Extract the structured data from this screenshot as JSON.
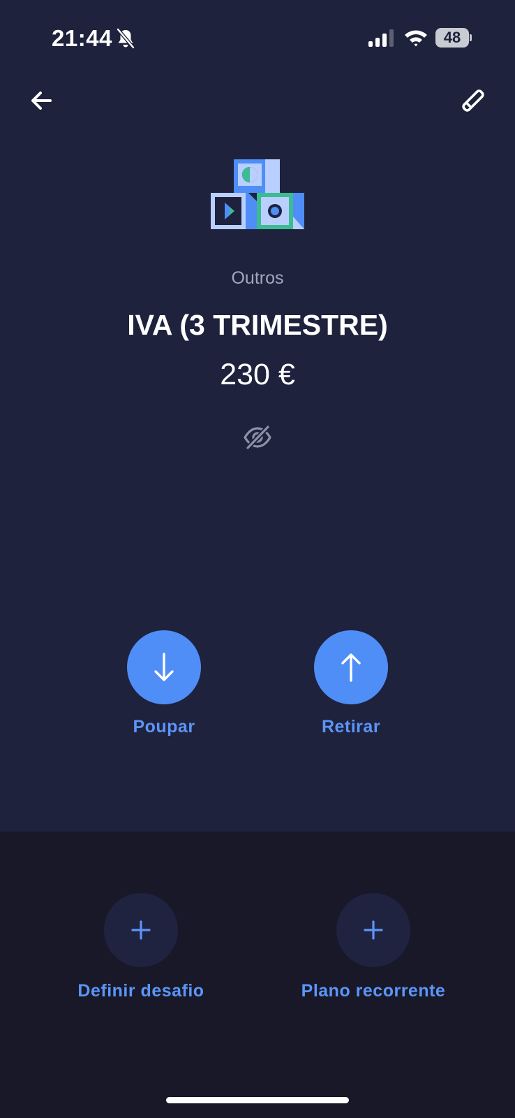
{
  "status_bar": {
    "time": "21:44",
    "battery": "48",
    "icons": [
      "bell-slash-icon",
      "signal-icon",
      "wifi-icon",
      "battery-icon"
    ]
  },
  "header": {
    "back_icon": "arrow-left-icon",
    "edit_icon": "pencil-icon"
  },
  "vault": {
    "category": "Outros",
    "name": "IVA (3 TRIMESTRE)",
    "amount": "230 €",
    "visibility_icon": "eye-slash-icon"
  },
  "actions": [
    {
      "label": "Poupar",
      "icon": "arrow-down-icon"
    },
    {
      "label": "Retirar",
      "icon": "arrow-up-icon"
    }
  ],
  "options": [
    {
      "label": "Definir desafio",
      "icon": "plus-icon"
    },
    {
      "label": "Plano recorrente",
      "icon": "plus-icon"
    }
  ],
  "colors": {
    "background": "#1e223d",
    "panel": "#181828",
    "accent": "#4f8ef7",
    "accent_text": "#5c95f7",
    "muted_text": "#a3a8bd"
  }
}
